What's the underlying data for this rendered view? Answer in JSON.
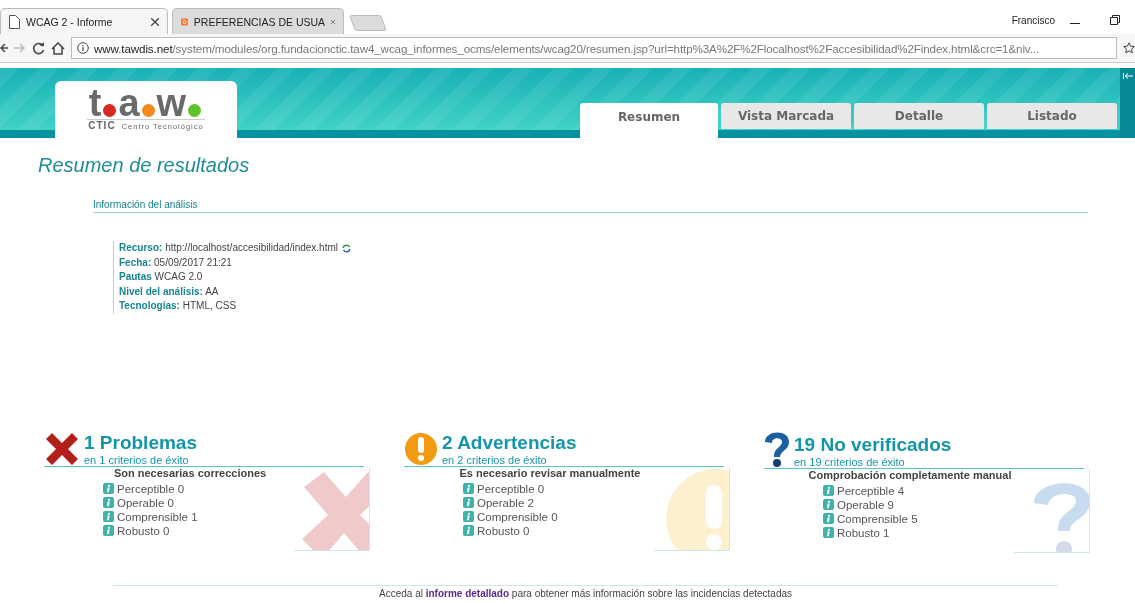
{
  "browser": {
    "tabs": [
      {
        "title": "WCAG 2 - Informe",
        "kind": "page",
        "selected": true
      },
      {
        "title": "PREFERENCIAS DE USUA",
        "kind": "app",
        "selected": false
      }
    ],
    "profile": "Francisco",
    "address": {
      "host": "www.tawdis.net",
      "path": "/system/modules/org.fundacionctic.taw4_wcag_informes_ocms/elements/wcag20/resumen.jsp?url=http%3A%2F%2Flocalhost%2Faccesibilidad%2Findex.html&crc=1&niv..."
    }
  },
  "logo": {
    "letters": [
      {
        "char": "t",
        "color": "#d42a22"
      },
      {
        "char": "a",
        "color": "#f58a1f"
      },
      {
        "char": "w",
        "color": "#5ec22a"
      }
    ],
    "org": "CTIC",
    "tagline": "Centro Tecnológico"
  },
  "tabs": [
    {
      "label": "Resumen",
      "selected": true
    },
    {
      "label": "Vista Marcada",
      "selected": false
    },
    {
      "label": "Detalle",
      "selected": false
    },
    {
      "label": "Listado",
      "selected": false
    }
  ],
  "title": "Resumen de resultados",
  "info": {
    "heading": "Información del análisis",
    "fields": [
      {
        "label": "Recurso:",
        "value": "http://localhost/accesibilidad/index.html",
        "kind": "resource"
      },
      {
        "label": "Fecha:",
        "value": "05/09/2017 21:21",
        "kind": "plain"
      },
      {
        "label": "Pautas",
        "value": "WCAG 2.0",
        "kind": "plain"
      },
      {
        "label": "Nivel del análisis:",
        "value": "AA",
        "kind": "plain"
      },
      {
        "label": "Tecnologías:",
        "value": "HTML, CSS",
        "kind": "plain"
      }
    ]
  },
  "summary": [
    {
      "kind": "error",
      "heading": "1 Problemas",
      "subtitle": "en 1 criterios de éxito",
      "note": "Son necesarias correcciones",
      "items": [
        "Perceptible 0",
        "Operable 0",
        "Comprensible 1",
        "Robusto 0"
      ]
    },
    {
      "kind": "warning",
      "heading": "2 Advertencias",
      "subtitle": "en 2 criterios de éxito",
      "note": "Es necesario revisar manualmente",
      "items": [
        "Perceptible 0",
        "Operable 2",
        "Comprensible 0",
        "Robusto 0"
      ]
    },
    {
      "kind": "unknown",
      "heading": "19 No verificados",
      "subtitle": "en 19 criterios de éxito",
      "note": "Comprobación completamente manual",
      "items": [
        "Perceptible 4",
        "Operable 9",
        "Comprensible 5",
        "Robusto 1"
      ]
    }
  ],
  "footer": {
    "before": "Acceda al",
    "link": "informe detallado",
    "after": "para obtener más información sobre las incidencias detectadas"
  }
}
